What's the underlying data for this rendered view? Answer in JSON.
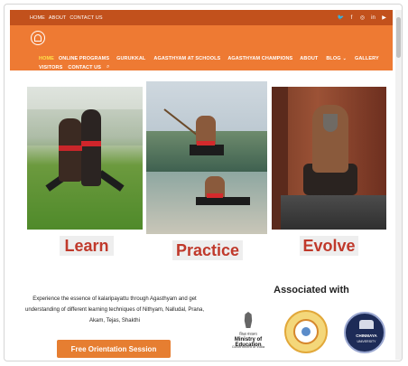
{
  "topbar": {
    "links": [
      "HOME",
      "ABOUT",
      "CONTACT US"
    ],
    "social_icons": [
      "twitter-icon",
      "facebook-icon",
      "instagram-icon",
      "linkedin-icon",
      "youtube-icon"
    ]
  },
  "nav": {
    "items": [
      "HOME",
      "ONLINE PROGRAMS",
      "GURUKKAL",
      "AGASTHYAM AT SCHOOLS",
      "AGASTHYAM CHAMPIONS",
      "ABOUT",
      "BLOG",
      "GALLERY"
    ],
    "items_row2": [
      "VISITORS",
      "CONTACT US"
    ],
    "active": "HOME"
  },
  "gallery": {
    "captions": [
      "Learn",
      "Practice",
      "Evolve"
    ]
  },
  "intro": {
    "description": "Experience the essence of kalaripayattu through Agasthyam and get understanding of different learning techniques of Nithyam, Nalludal, Prana, Akam, Tejas, Shakthi",
    "cta_label": "Free Orientation Session"
  },
  "associations": {
    "title": "Associated with",
    "ministry": {
      "hindi": "शिक्षा मंत्रालय",
      "name": "Ministry of Education",
      "sub": "Government of India"
    },
    "university": {
      "name": "CHINMAYA",
      "sub": "UNIVERSITY"
    }
  },
  "colors": {
    "topbar": "#c2511c",
    "navbar": "#ee7a33",
    "accent": "#ffe24a",
    "caption": "#c0392b",
    "cta": "#e67e31"
  }
}
